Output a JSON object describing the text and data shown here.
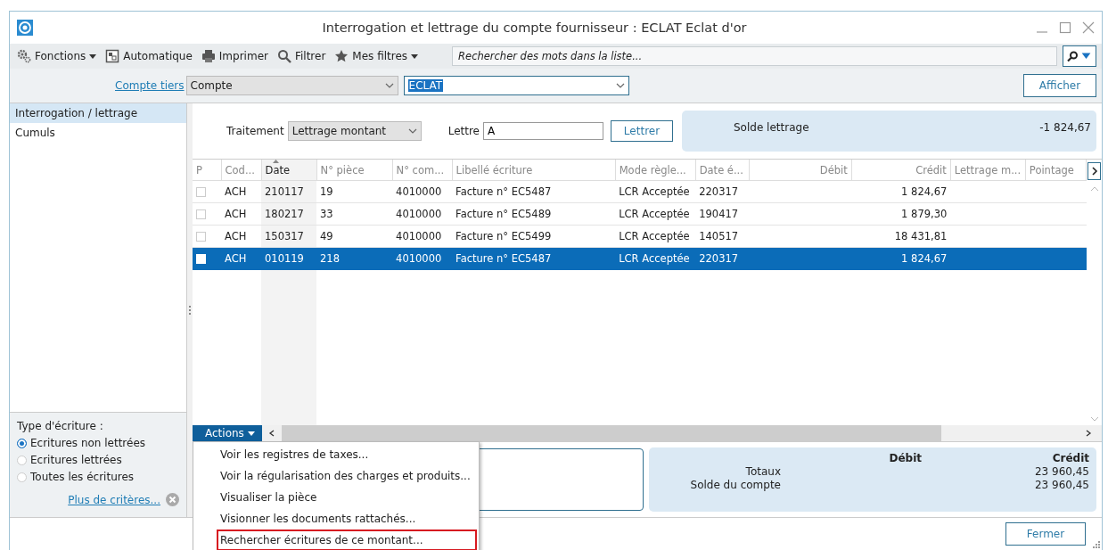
{
  "window": {
    "title": "Interrogation et lettrage du compte fournisseur : ECLAT Eclat d'or"
  },
  "toolbar": {
    "buttons": [
      {
        "label": "Fonctions",
        "dropdown": true
      },
      {
        "label": "Automatique",
        "dropdown": false
      },
      {
        "label": "Imprimer",
        "dropdown": false
      },
      {
        "label": "Filtrer",
        "dropdown": false
      },
      {
        "label": "Mes filtres",
        "dropdown": true
      }
    ],
    "search": {
      "placeholder": "Rechercher des mots dans la liste..."
    }
  },
  "account_bar": {
    "link": "Compte tiers",
    "type_select": "Compte",
    "account_value": "ECLAT",
    "button": "Afficher"
  },
  "sidebar": {
    "items": [
      {
        "label": "Interrogation / lettrage",
        "selected": true
      },
      {
        "label": "Cumuls",
        "selected": false
      }
    ],
    "filter": {
      "title": "Type d'écriture :",
      "options": [
        {
          "label": "Ecritures non lettrées",
          "selected": true
        },
        {
          "label": "Ecritures lettrées",
          "selected": false
        },
        {
          "label": "Toutes les écritures",
          "selected": false
        }
      ],
      "link": "Plus de critères..."
    }
  },
  "lettering": {
    "treatment_label": "Traitement",
    "treatment_value": "Lettrage montant",
    "letter_label": "Lettre",
    "letter_value": "A",
    "button": "Lettrer",
    "balance_label": "Solde lettrage",
    "balance_value": "-1 824,67"
  },
  "table": {
    "columns": [
      {
        "label": "P",
        "sorted": false
      },
      {
        "label": "Cod...",
        "sorted": false
      },
      {
        "label": "Date",
        "sorted": true
      },
      {
        "label": "N° pièce",
        "sorted": false
      },
      {
        "label": "N° com...",
        "sorted": false
      },
      {
        "label": "Libellé écriture",
        "sorted": false
      },
      {
        "label": "Mode règle...",
        "sorted": false
      },
      {
        "label": "Date é...",
        "sorted": false
      },
      {
        "label": "Débit",
        "sorted": false
      },
      {
        "label": "Crédit",
        "sorted": false
      },
      {
        "label": "Lettrage m...",
        "sorted": false
      },
      {
        "label": "Pointage",
        "sorted": false
      }
    ],
    "rows": [
      {
        "selected": false,
        "checked": false,
        "cells": [
          "",
          "ACH",
          "210117",
          "19",
          "4010000",
          "Facture n° EC5487",
          "LCR Acceptée",
          "220317",
          "",
          "1 824,67"
        ]
      },
      {
        "selected": false,
        "checked": false,
        "cells": [
          "",
          "ACH",
          "180217",
          "33",
          "4010000",
          "Facture n° EC5489",
          "LCR Acceptée",
          "190417",
          "",
          "1 879,30"
        ]
      },
      {
        "selected": false,
        "checked": false,
        "cells": [
          "",
          "ACH",
          "150317",
          "49",
          "4010000",
          "Facture n° EC5499",
          "LCR Acceptée",
          "140517",
          "",
          "18 431,81"
        ]
      },
      {
        "selected": true,
        "checked": false,
        "cells": [
          "",
          "ACH",
          "010119",
          "218",
          "4010000",
          "Facture n° EC5487",
          "LCR Acceptée",
          "220317",
          "",
          "1 824,67"
        ]
      }
    ]
  },
  "actions_menu": {
    "label": "Actions",
    "items": [
      {
        "label": "Voir les registres de taxes...",
        "marked": false
      },
      {
        "label": "Voir la régularisation des charges et produits...",
        "marked": false
      },
      {
        "label": "Visualiser la pièce",
        "marked": false
      },
      {
        "label": "Visionner les documents rattachés...",
        "marked": false
      },
      {
        "label": "Rechercher écritures de ce montant...",
        "marked": true
      }
    ]
  },
  "totals": {
    "headers": [
      "Débit",
      "Crédit"
    ],
    "rows": [
      {
        "label": "Totaux",
        "credit": "23 960,45"
      },
      {
        "label": "Solde du compte",
        "credit": "23 960,45"
      }
    ]
  },
  "footer": {
    "button": "Fermer"
  }
}
